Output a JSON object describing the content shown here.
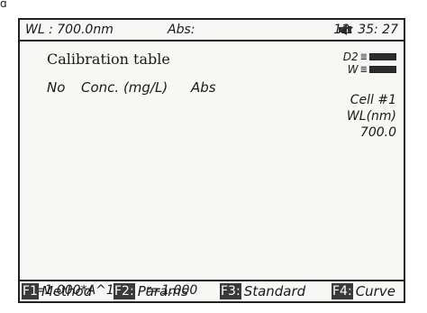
{
  "status": {
    "wavelength": "WL : 700.0nm",
    "abs": "Abs:",
    "time": "12: 35: 27"
  },
  "calibration": {
    "title": "Calibration table",
    "columns": [
      "No",
      "Conc. (mg/L)",
      "Abs"
    ]
  },
  "lamps": [
    {
      "label": "D2",
      "arrow": "≣"
    },
    {
      "label": "W",
      "arrow": "≣"
    }
  ],
  "cell": "Cell  #1",
  "wl_header": "WL(nm)",
  "wl_value": "700.0",
  "formula": {
    "equation": "C=1.000*A^1",
    "r": "r=1.000"
  },
  "function_keys": [
    {
      "key": "F1",
      "label": "Method"
    },
    {
      "key": "F2:",
      "label": "Params"
    },
    {
      "key": "F3:",
      "label": "Standard"
    },
    {
      "key": "F4:",
      "label": "Curve"
    }
  ],
  "icons": {
    "sound": "speaker-icon"
  }
}
